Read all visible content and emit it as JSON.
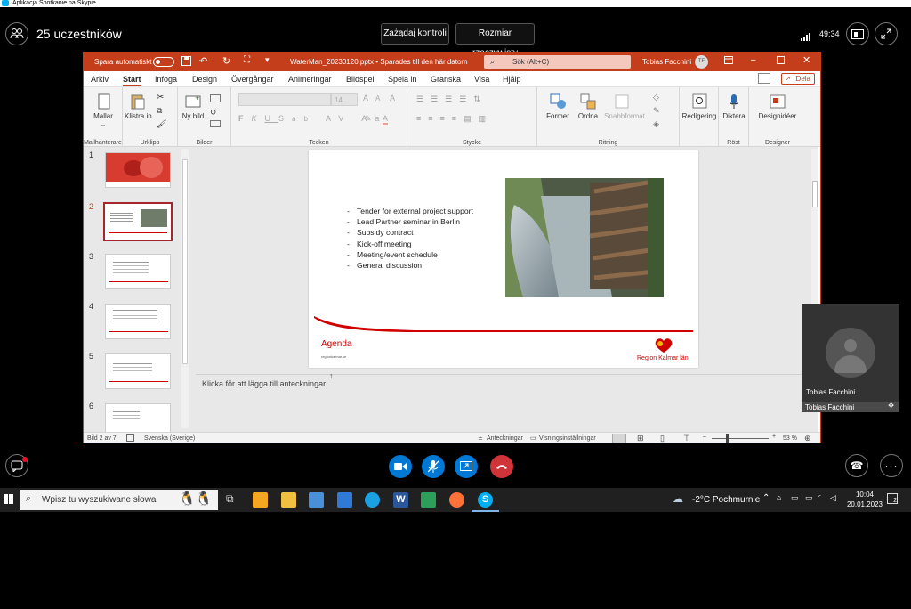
{
  "window": {
    "title": "Aplikacja Spotkanie na Skypie"
  },
  "call": {
    "participants_label": "25 uczestników",
    "request_control_label": "Zażądaj kontroli",
    "actual_size_label": "Rozmiar rzeczywisty",
    "timer": "49:34",
    "self_view_name": "Tobias Facchini",
    "self_view_footer": "Tobias Facchini"
  },
  "ppt": {
    "autosave_label": "Spara automatiskt",
    "file_title": "WaterMan_20230120.pptx • Sparades till den här datorn",
    "search_placeholder": "Sök (Alt+C)",
    "user_name": "Tobias Facchini",
    "user_initials": "TF",
    "share_label": "Dela",
    "tabs": [
      "Arkiv",
      "Start",
      "Infoga",
      "Design",
      "Övergångar",
      "Animeringar",
      "Bildspel",
      "Spela in",
      "Granska",
      "Visa",
      "Hjälp"
    ],
    "ribbon": {
      "mallar": "Mallar",
      "mallhanterare": "Mallhanterare",
      "klistra_in": "Klistra in",
      "urklipp": "Urklipp",
      "ny_bild": "Ny bild",
      "bilder": "Bilder",
      "font_size": "14",
      "tecken": "Tecken",
      "stycke": "Stycke",
      "former": "Former",
      "ordna": "Ordna",
      "snabbformat": "Snabbformat",
      "ritning": "Ritning",
      "redigering": "Redigering",
      "diktera": "Diktera",
      "rost": "Röst",
      "designideer": "Designidéer",
      "designer": "Designer"
    },
    "slide_numbers": [
      "1",
      "2",
      "3",
      "4",
      "5",
      "6"
    ],
    "slide": {
      "bullets": [
        "Tender for external project support",
        "Lead Partner seminar in Berlin",
        "Subsidy contract",
        "Kick-off meeting",
        "Meeting/event schedule",
        "General discussion"
      ],
      "footer_title": "Agenda",
      "footer_url": "regionkalmar.se",
      "logo_text": "Region Kalmar län"
    },
    "notes_placeholder": "Klicka för att lägga till anteckningar",
    "status": {
      "slide_count": "Bild 2 av 7",
      "language": "Svenska (Sverige)",
      "notes": "Anteckningar",
      "view_settings": "Visningsinställningar",
      "zoom": "53 %"
    }
  },
  "taskbar": {
    "search_placeholder": "Wpisz tu wyszukiwane słowa",
    "weather": "-2°C  Pochmurnie",
    "time": "10:04",
    "date": "20.01.2023",
    "notification_count": "2"
  },
  "colors": {
    "accent": "#c43e1c",
    "skype_blue": "#0078d4",
    "hangup": "#d13438"
  }
}
